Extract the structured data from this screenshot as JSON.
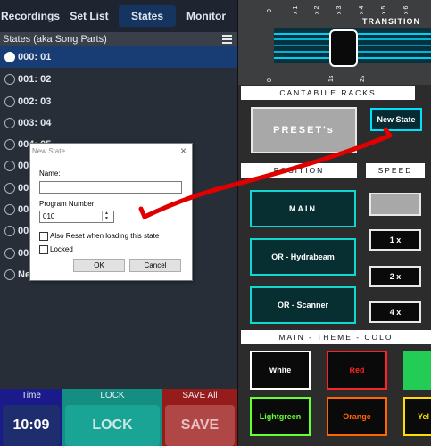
{
  "tabs": [
    "Recordings",
    "Set List",
    "States",
    "Monitor"
  ],
  "states_header": "States (aka Song Parts)",
  "states": [
    {
      "label": "000: 01",
      "selected": true
    },
    {
      "label": "001: 02",
      "selected": false
    },
    {
      "label": "002: 03",
      "selected": false
    },
    {
      "label": "003: 04",
      "selected": false
    },
    {
      "label": "004: 05",
      "selected": false
    },
    {
      "label": "005",
      "selected": false
    },
    {
      "label": "006",
      "selected": false
    },
    {
      "label": "007",
      "selected": false
    },
    {
      "label": "008",
      "selected": false
    },
    {
      "label": "009",
      "selected": false
    },
    {
      "label": "Ne",
      "selected": false
    }
  ],
  "bottom": {
    "time_label": "Time",
    "time_value": "10:09",
    "lock_label": "LOCK",
    "lock_value": "LOCK",
    "save_label": "SAVE All",
    "save_value": "SAVE"
  },
  "dialog": {
    "title": "New State",
    "name_label": "Name:",
    "name_value": "",
    "program_label": "Program Number",
    "program_value": "010",
    "reset_label": "Also Reset when loading this state",
    "locked_label": "Locked",
    "ok": "OK",
    "cancel": "Cancel"
  },
  "right": {
    "ticks_top": [
      "0",
      "x 1",
      "x 2",
      "x 3",
      "x 4",
      "x 5",
      "x 6"
    ],
    "ticks_bottom": [
      "0",
      "1s",
      "2s"
    ],
    "transition": "TRANSITION",
    "cantabile_racks": "CANTABILE RACKS",
    "presets": "PRESET's",
    "new_state": "New State",
    "position": "POSITION",
    "speed": "SPEED",
    "main": "MAIN",
    "or_hydrabeam": "OR - Hydrabeam",
    "or_scanner": "OR - Scanner",
    "speeds": [
      "1 x",
      "2 x",
      "4 x"
    ],
    "theme": "MAIN - THEME - COLO",
    "colors": [
      {
        "label": "White",
        "color": "#ffffff"
      },
      {
        "label": "Red",
        "color": "#ff2222"
      },
      {
        "label": "",
        "color": "#22cc55"
      },
      {
        "label": "Lightgreen",
        "color": "#66ff33"
      },
      {
        "label": "Orange",
        "color": "#ff6600"
      },
      {
        "label": "Yel",
        "color": "#ffdd00"
      }
    ]
  },
  "colors": {
    "accent": "#00e0ff",
    "tab_active": "#15345f",
    "selected_row": "#173d74",
    "arrow": "#e00000"
  }
}
